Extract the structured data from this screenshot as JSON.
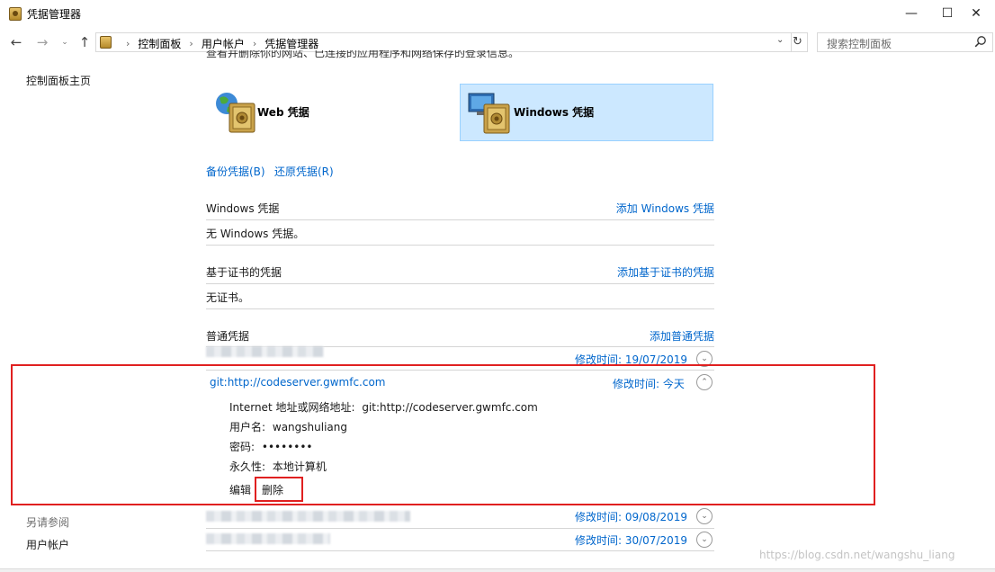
{
  "window": {
    "title": "凭据管理器",
    "min_glyph": "—",
    "max_glyph": "☐",
    "close_glyph": "✕"
  },
  "nav": {
    "back_glyph": "←",
    "forward_glyph": "→",
    "recent_glyph": "⌄",
    "up_glyph": "↑",
    "breadcrumbs": [
      "控制面板",
      "用户帐户",
      "凭据管理器"
    ],
    "crumb_sep": "›",
    "dropdown_glyph": "⌄",
    "refresh_glyph": "↻",
    "search_placeholder": "搜索控制面板"
  },
  "sidebar": {
    "home": "控制面板主页",
    "see_also": "另请参阅",
    "user_accounts": "用户帐户"
  },
  "intro_text": "查看并删除你的网站、已连接的应用程序和网络保存的登录信息。",
  "tiles": {
    "web": "Web 凭据",
    "windows": "Windows 凭据"
  },
  "actions": {
    "backup": "备份凭据(B)",
    "restore": "还原凭据(R)"
  },
  "sections": {
    "windows": {
      "title": "Windows 凭据",
      "add": "添加 Windows 凭据",
      "empty": "无 Windows 凭据。"
    },
    "cert": {
      "title": "基于证书的凭据",
      "add": "添加基于证书的凭据",
      "empty": "无证书。"
    },
    "generic": {
      "title": "普通凭据",
      "add": "添加普通凭据"
    }
  },
  "credentials": [
    {
      "modified": "修改时间:  19/07/2019",
      "expanded": false
    },
    {
      "name": "git:http://codeserver.gwmfc.com",
      "modified": "修改时间:  今天",
      "expanded": true,
      "address_label": "Internet 地址或网络地址:",
      "address": "git:http://codeserver.gwmfc.com",
      "username_label": "用户名:",
      "username": "wangshuliang",
      "password_label": "密码:",
      "password": "••••••••",
      "persistence_label": "永久性:",
      "persistence": "本地计算机",
      "edit": "编辑",
      "delete": "删除"
    },
    {
      "modified": "修改时间:  09/08/2019",
      "expanded": false
    },
    {
      "modified": "修改时间:  30/07/2019",
      "expanded": false
    }
  ],
  "chevron_down": "⌄",
  "chevron_up": "⌃",
  "watermark": "https://blog.csdn.net/wangshu_liang",
  "colors": {
    "link": "#0066cc",
    "selected_tile": "#cce8ff",
    "highlight": "#e02020"
  }
}
